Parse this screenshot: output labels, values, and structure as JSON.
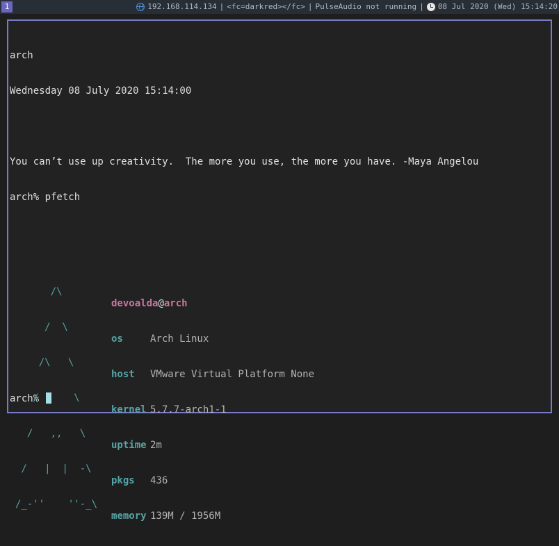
{
  "bar": {
    "workspace": "1",
    "ip": "192.168.114.134",
    "vpn": "<fc=darkred></fc>",
    "audio": "PulseAudio not running",
    "datetime": "08 Jul 2020 (Wed) 15:14:20",
    "colors": {
      "accent": "#6a66c0",
      "background": "#272e36",
      "text": "#aeb9c4"
    },
    "icons": {
      "network": "globe-icon",
      "clock": "clock-icon"
    }
  },
  "terminal": {
    "lines": {
      "hostname": "arch",
      "date": "Wednesday 08 July 2020 15:14:00",
      "quote": "You can’t use up creativity.  The more you use, the more you have. -Maya Angelou",
      "command": "arch% pfetch",
      "prompt": "arch% "
    },
    "logo": [
      "      /\\",
      "     /  \\",
      "    /\\   \\",
      "   /      \\",
      "  /   ,,   \\",
      " /   |  |  -\\",
      "/_-''    ''-_\\"
    ],
    "pfetch": {
      "user": "devoalda",
      "at": "@",
      "host_name": "arch",
      "rows": [
        {
          "label": "os",
          "value": "Arch Linux"
        },
        {
          "label": "host",
          "value": "VMware Virtual Platform None"
        },
        {
          "label": "kernel",
          "value": "5.7.7-arch1-1"
        },
        {
          "label": "uptime",
          "value": "2m"
        },
        {
          "label": "pkgs",
          "value": "436"
        },
        {
          "label": "memory",
          "value": "139M / 1956M"
        }
      ]
    },
    "colors": {
      "border": "#7a7bc8",
      "logo": "#56a4a6",
      "user": "#c877a0",
      "cursor": "#a6dfe8"
    }
  }
}
